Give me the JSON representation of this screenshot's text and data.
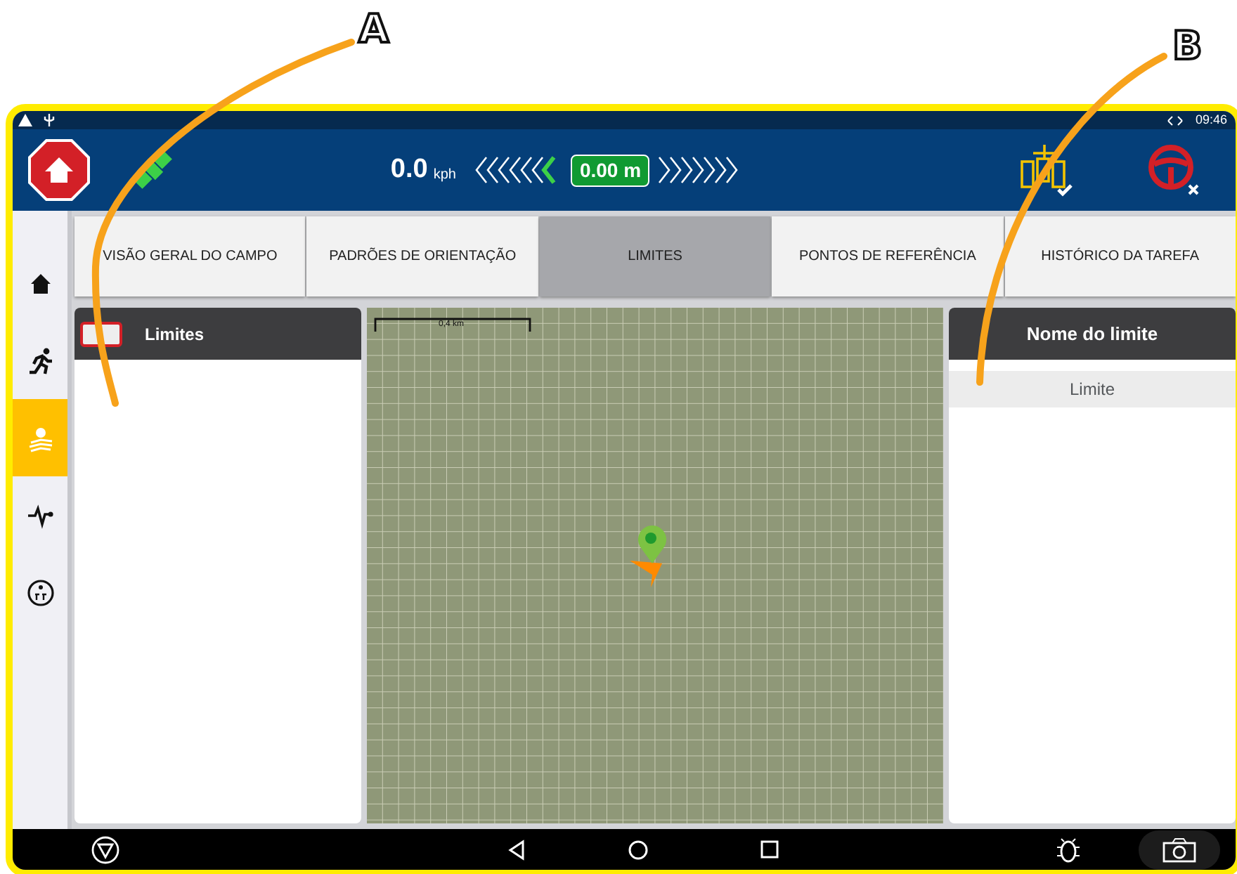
{
  "annotations": [
    {
      "label": "A"
    },
    {
      "label": "B"
    }
  ],
  "status_bar": {
    "time": "09:46"
  },
  "header": {
    "speed": "0.0",
    "speed_unit": "kph",
    "offset": "0.00 m"
  },
  "tabs": [
    {
      "label": "VISÃO GERAL DO CAMPO",
      "selected": false
    },
    {
      "label": "PADRÕES DE ORIENTAÇÃO",
      "selected": false
    },
    {
      "label": "LIMITES",
      "selected": true
    },
    {
      "label": "PONTOS DE REFERÊNCIA",
      "selected": false
    },
    {
      "label": "HISTÓRICO DA TAREFA",
      "selected": false
    }
  ],
  "sidebar": {
    "items": [
      {
        "kind": "home",
        "selected": false
      },
      {
        "kind": "runner",
        "selected": false
      },
      {
        "kind": "field",
        "selected": true
      },
      {
        "kind": "pulse",
        "selected": false
      },
      {
        "kind": "ut",
        "selected": false
      }
    ]
  },
  "left_panel": {
    "title": "Limites"
  },
  "map": {
    "scale": "0,4 km"
  },
  "right_panel": {
    "title": "Nome do limite",
    "field": {
      "placeholder": "Limite"
    }
  }
}
